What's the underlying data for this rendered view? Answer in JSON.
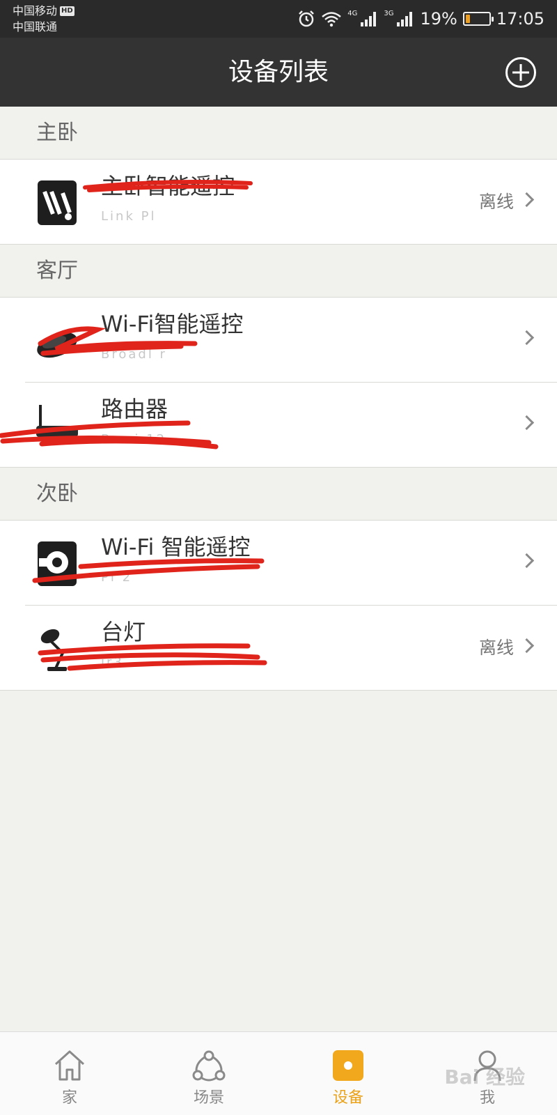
{
  "status_bar": {
    "carrier_1": "中国移动",
    "hd_badge": "HD",
    "carrier_2": "中国联通",
    "net_1": "4G",
    "net_2": "3G",
    "battery_percent": "19%",
    "battery_level": 0.19,
    "time": "17:05"
  },
  "header": {
    "title": "设备列表",
    "add_icon": "plus-circle-icon"
  },
  "sections": [
    {
      "name": "主卧",
      "devices": [
        {
          "name": "主卧智能遥控",
          "sub": "Link Pl",
          "status": "离线",
          "icon": "remote-icon"
        }
      ]
    },
    {
      "name": "客厅",
      "devices": [
        {
          "name": "Wi-Fi智能遥控",
          "sub": "Broadl r",
          "status": "",
          "icon": "remote-puck-icon"
        },
        {
          "name": "路由器",
          "sub": "Br ai 12",
          "status": "",
          "icon": "router-icon"
        }
      ]
    },
    {
      "name": "次卧",
      "devices": [
        {
          "name": "Wi-Fi 智能遥控",
          "sub": "Pl 2",
          "status": "",
          "icon": "remote-icon"
        },
        {
          "name": "台灯",
          "sub": "ir3",
          "status": "离线",
          "icon": "desk-lamp-icon"
        }
      ]
    }
  ],
  "tab_bar": {
    "tabs": [
      {
        "label": "家",
        "icon": "home-icon"
      },
      {
        "label": "场景",
        "icon": "scene-icon"
      },
      {
        "label": "设备",
        "icon": "device-icon",
        "active": true
      },
      {
        "label": "我",
        "icon": "profile-icon"
      }
    ]
  },
  "colors": {
    "accent": "#e9a21a",
    "nav_bg": "#333333",
    "page_bg": "#f1f1ed"
  },
  "watermark": "Bai 经验"
}
